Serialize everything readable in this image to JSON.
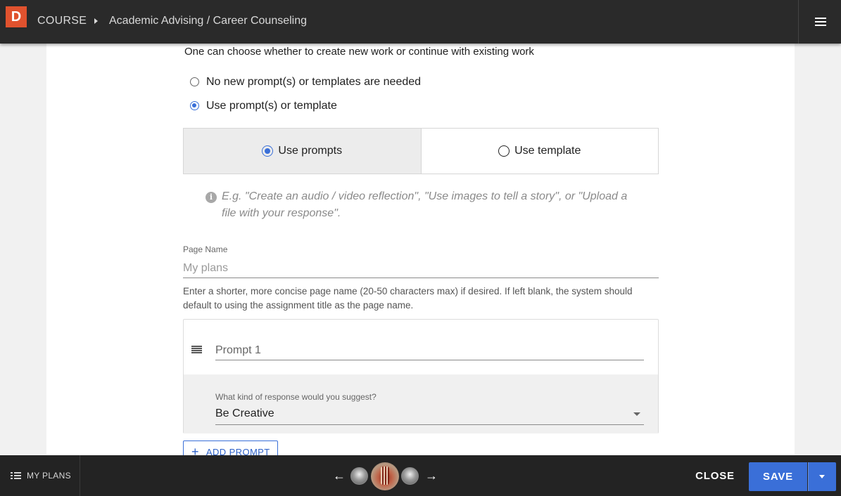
{
  "header": {
    "logo_letter": "D",
    "breadcrumb_course": "COURSE",
    "breadcrumb_title": "Academic Advising / Career Counseling",
    "menu_icon": "hamburger-menu-icon"
  },
  "form": {
    "intro_text": "One can choose whether to create new work or continue with existing work",
    "options": [
      {
        "label": "No new prompt(s) or templates are needed",
        "selected": false
      },
      {
        "label": "Use prompt(s) or template",
        "selected": true
      }
    ],
    "segmented": [
      {
        "label": "Use prompts",
        "selected": true
      },
      {
        "label": "Use template",
        "selected": false
      }
    ],
    "hint": "E.g. \"Create an audio / video reflection\", \"Use images to tell a story\", or \"Upload a file with your response\".",
    "page_name_label": "Page Name",
    "page_name_placeholder": "My plans",
    "page_name_help": "Enter a shorter, more concise page name (20-50 characters max) if desired. If left blank, the system should default to using the assignment title as the page name.",
    "prompt": {
      "placeholder": "Prompt 1",
      "response_label": "What kind of response would you suggest?",
      "response_value": "Be Creative"
    },
    "add_prompt_label": "ADD PROMPT"
  },
  "footer": {
    "my_plans_label": "MY PLANS",
    "close_label": "CLOSE",
    "save_label": "SAVE"
  },
  "colors": {
    "accent": "#3a6fd8",
    "topbar": "#2a2a2a",
    "bottombar": "#232323",
    "logo": "#e0522e"
  }
}
